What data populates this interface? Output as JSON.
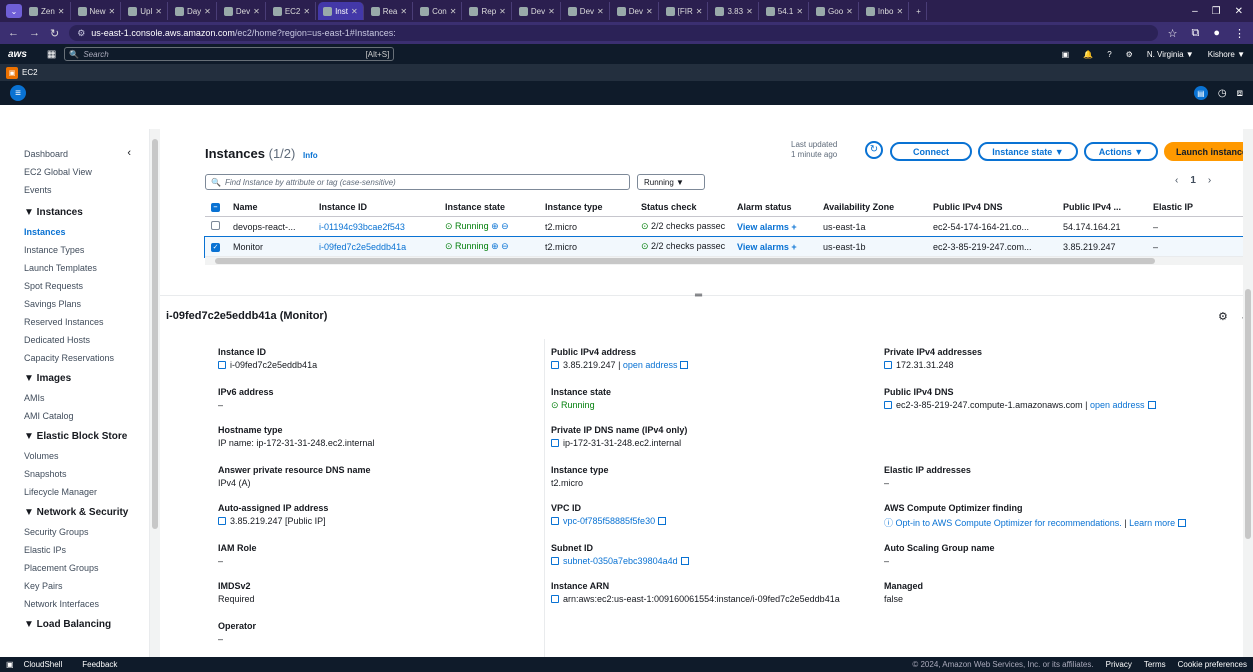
{
  "browser": {
    "tabs": [
      {
        "label": "Zen"
      },
      {
        "label": "New"
      },
      {
        "label": "Upl"
      },
      {
        "label": "Day"
      },
      {
        "label": "Dev"
      },
      {
        "label": "EC2"
      },
      {
        "label": "Inst",
        "active": true
      },
      {
        "label": "Rea"
      },
      {
        "label": "Con"
      },
      {
        "label": "Rep"
      },
      {
        "label": "Dev"
      },
      {
        "label": "Dev"
      },
      {
        "label": "Dev"
      },
      {
        "label": "[FIR"
      },
      {
        "label": "3.83"
      },
      {
        "label": "54.1"
      },
      {
        "label": "Goo"
      },
      {
        "label": "Inbo"
      }
    ],
    "url_host": "us-east-1.console.aws.amazon.com",
    "url_path": "/ec2/home?region=us-east-1#Instances:"
  },
  "aws": {
    "logo": "aws",
    "search_placeholder": "Search",
    "search_shortcut": "[Alt+S]",
    "region": "N. Virginia ▼",
    "user": "Kishore ▼",
    "service": "EC2"
  },
  "sidebar": {
    "top": [
      "Dashboard",
      "EC2 Global View",
      "Events"
    ],
    "groups": [
      {
        "title": "▼ Instances",
        "items": [
          "Instances",
          "Instance Types",
          "Launch Templates",
          "Spot Requests",
          "Savings Plans",
          "Reserved Instances",
          "Dedicated Hosts",
          "Capacity Reservations"
        ]
      },
      {
        "title": "▼ Images",
        "items": [
          "AMIs",
          "AMI Catalog"
        ]
      },
      {
        "title": "▼ Elastic Block Store",
        "items": [
          "Volumes",
          "Snapshots",
          "Lifecycle Manager"
        ]
      },
      {
        "title": "▼ Network & Security",
        "items": [
          "Security Groups",
          "Elastic IPs",
          "Placement Groups",
          "Key Pairs",
          "Network Interfaces"
        ]
      },
      {
        "title": "▼ Load Balancing",
        "items": []
      }
    ]
  },
  "instances": {
    "title": "Instances",
    "count": "(1/2)",
    "info": "Info",
    "last_updated_1": "Last updated",
    "last_updated_2": "1 minute ago",
    "connect": "Connect",
    "instance_state": "Instance state ▼",
    "actions": "Actions ▼",
    "launch": "Launch instances",
    "filter_placeholder": "Find Instance by attribute or tag (case-sensitive)",
    "state_filter": "Running ▼",
    "page": "1",
    "columns": [
      "Name",
      "Instance ID",
      "Instance state",
      "Instance type",
      "Status check",
      "Alarm status",
      "Availability Zone",
      "Public IPv4 DNS",
      "Public IPv4 ...",
      "Elastic IP"
    ],
    "rows": [
      {
        "name": "devops-react-...",
        "id": "i-01194c93bcae2f543",
        "state": "Running",
        "type": "t2.micro",
        "check": "2/2 checks passec",
        "alarm": "View alarms +",
        "az": "us-east-1a",
        "dns": "ec2-54-174-164-21.co...",
        "ip": "54.174.164.21",
        "eip": "–",
        "selected": false
      },
      {
        "name": "Monitor",
        "id": "i-09fed7c2e5eddb41a",
        "state": "Running",
        "type": "t2.micro",
        "check": "2/2 checks passec",
        "alarm": "View alarms +",
        "az": "us-east-1b",
        "dns": "ec2-3-85-219-247.com...",
        "ip": "3.85.219.247",
        "eip": "–",
        "selected": true
      }
    ]
  },
  "details": {
    "title": "i-09fed7c2e5eddb41a (Monitor)",
    "col1": [
      {
        "k": "Instance ID",
        "v": "i-09fed7c2e5eddb41a"
      },
      {
        "k": "IPv6 address",
        "v": "–"
      },
      {
        "k": "Hostname type",
        "v": "IP name: ip-172-31-31-248.ec2.internal"
      },
      {
        "k": "Answer private resource DNS name",
        "v": "IPv4 (A)"
      },
      {
        "k": "Auto-assigned IP address",
        "v": "3.85.219.247 [Public IP]"
      },
      {
        "k": "IAM Role",
        "v": "–"
      },
      {
        "k": "IMDSv2",
        "v": "Required"
      },
      {
        "k": "Operator",
        "v": "–"
      }
    ],
    "col2": [
      {
        "k": "Public IPv4 address",
        "v": "3.85.219.247",
        "link": "open address"
      },
      {
        "k": "Instance state",
        "v": "Running"
      },
      {
        "k": "Private IP DNS name (IPv4 only)",
        "v": "ip-172-31-31-248.ec2.internal"
      },
      {
        "k": "Instance type",
        "v": "t2.micro"
      },
      {
        "k": "VPC ID",
        "v": "vpc-0f785f58885f5fe30"
      },
      {
        "k": "Subnet ID",
        "v": "subnet-0350a7ebc39804a4d"
      },
      {
        "k": "Instance ARN",
        "v": "arn:aws:ec2:us-east-1:009160061554:instance/i-09fed7c2e5eddb41a"
      }
    ],
    "col3": [
      {
        "k": "Private IPv4 addresses",
        "v": "172.31.31.248"
      },
      {
        "k": "Public IPv4 DNS",
        "v": "ec2-3-85-219-247.compute-1.amazonaws.com",
        "link": "open address"
      },
      {
        "k": "Elastic IP addresses",
        "v": "–"
      },
      {
        "k": "AWS Compute Optimizer finding",
        "v": "Opt-in to AWS Compute Optimizer for recommendations.",
        "link": "Learn more"
      },
      {
        "k": "Auto Scaling Group name",
        "v": "–"
      },
      {
        "k": "Managed",
        "v": "false"
      }
    ]
  },
  "footer": {
    "cloudshell": "CloudShell",
    "feedback": "Feedback",
    "copyright": "© 2024, Amazon Web Services, Inc. or its affiliates.",
    "privacy": "Privacy",
    "terms": "Terms",
    "cookies": "Cookie preferences"
  }
}
